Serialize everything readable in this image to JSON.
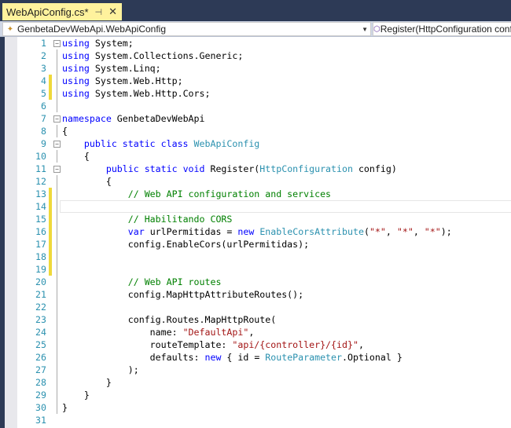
{
  "tab": {
    "title": "WebApiConfig.cs*",
    "pin_icon": "pin-icon",
    "close_icon": "close-icon"
  },
  "nav": {
    "class_combo": "GenbetaDevWebApi.WebApiConfig",
    "member_combo": "Register(HttpConfiguration config)"
  },
  "colors": {
    "keyword": "#0000ff",
    "type": "#2b91af",
    "string": "#a31515",
    "comment": "#008000",
    "changed": "#efd93b"
  },
  "lines": [
    {
      "n": "1",
      "fold": true,
      "chg": false,
      "tokens": [
        [
          "k",
          "using"
        ],
        [
          "p",
          " System;"
        ]
      ]
    },
    {
      "n": "2",
      "tokens": [
        [
          "k",
          "using"
        ],
        [
          "p",
          " System.Collections.Generic;"
        ]
      ]
    },
    {
      "n": "3",
      "tokens": [
        [
          "k",
          "using"
        ],
        [
          "p",
          " System.Linq;"
        ]
      ]
    },
    {
      "n": "4",
      "chg": true,
      "tokens": [
        [
          "k",
          "using"
        ],
        [
          "p",
          " System.Web.Http;"
        ]
      ]
    },
    {
      "n": "5",
      "chg": true,
      "tokens": [
        [
          "k",
          "using"
        ],
        [
          "p",
          " System.Web.Http.Cors;"
        ]
      ]
    },
    {
      "n": "6",
      "tokens": []
    },
    {
      "n": "7",
      "fold": true,
      "tokens": [
        [
          "k",
          "namespace"
        ],
        [
          "p",
          " GenbetaDevWebApi"
        ]
      ]
    },
    {
      "n": "8",
      "tokens": [
        [
          "p",
          "{"
        ]
      ]
    },
    {
      "n": "9",
      "fold": true,
      "tokens": [
        [
          "p",
          "    "
        ],
        [
          "k",
          "public static class"
        ],
        [
          "p",
          " "
        ],
        [
          "t",
          "WebApiConfig"
        ]
      ]
    },
    {
      "n": "10",
      "tokens": [
        [
          "p",
          "    {"
        ]
      ]
    },
    {
      "n": "11",
      "fold": true,
      "tokens": [
        [
          "p",
          "        "
        ],
        [
          "k",
          "public static void"
        ],
        [
          "p",
          " Register("
        ],
        [
          "t",
          "HttpConfiguration"
        ],
        [
          "p",
          " config)"
        ]
      ]
    },
    {
      "n": "12",
      "tokens": [
        [
          "p",
          "        {"
        ]
      ]
    },
    {
      "n": "13",
      "chg": true,
      "tokens": [
        [
          "p",
          "            "
        ],
        [
          "c",
          "// Web API configuration and services"
        ]
      ]
    },
    {
      "n": "14",
      "chg": true,
      "cur": true,
      "tokens": []
    },
    {
      "n": "15",
      "chg": true,
      "tokens": [
        [
          "p",
          "            "
        ],
        [
          "c",
          "// Habilitando CORS"
        ]
      ]
    },
    {
      "n": "16",
      "chg": true,
      "tokens": [
        [
          "p",
          "            "
        ],
        [
          "k",
          "var"
        ],
        [
          "p",
          " urlPermitidas = "
        ],
        [
          "k",
          "new"
        ],
        [
          "p",
          " "
        ],
        [
          "t",
          "EnableCorsAttribute"
        ],
        [
          "p",
          "("
        ],
        [
          "s",
          "\"*\""
        ],
        [
          "p",
          ", "
        ],
        [
          "s",
          "\"*\""
        ],
        [
          "p",
          ", "
        ],
        [
          "s",
          "\"*\""
        ],
        [
          "p",
          ");"
        ]
      ]
    },
    {
      "n": "17",
      "chg": true,
      "tokens": [
        [
          "p",
          "            config.EnableCors(urlPermitidas);"
        ]
      ]
    },
    {
      "n": "18",
      "chg": true,
      "tokens": []
    },
    {
      "n": "19",
      "chg": true,
      "tokens": []
    },
    {
      "n": "20",
      "tokens": [
        [
          "p",
          "            "
        ],
        [
          "c",
          "// Web API routes"
        ]
      ]
    },
    {
      "n": "21",
      "tokens": [
        [
          "p",
          "            config.MapHttpAttributeRoutes();"
        ]
      ]
    },
    {
      "n": "22",
      "tokens": []
    },
    {
      "n": "23",
      "tokens": [
        [
          "p",
          "            config.Routes.MapHttpRoute("
        ]
      ]
    },
    {
      "n": "24",
      "tokens": [
        [
          "p",
          "                name: "
        ],
        [
          "s",
          "\"DefaultApi\""
        ],
        [
          "p",
          ","
        ]
      ]
    },
    {
      "n": "25",
      "tokens": [
        [
          "p",
          "                routeTemplate: "
        ],
        [
          "s",
          "\"api/{controller}/{id}\""
        ],
        [
          "p",
          ","
        ]
      ]
    },
    {
      "n": "26",
      "tokens": [
        [
          "p",
          "                defaults: "
        ],
        [
          "k",
          "new"
        ],
        [
          "p",
          " { id = "
        ],
        [
          "t",
          "RouteParameter"
        ],
        [
          "p",
          ".Optional }"
        ]
      ]
    },
    {
      "n": "27",
      "tokens": [
        [
          "p",
          "            );"
        ]
      ]
    },
    {
      "n": "28",
      "tokens": [
        [
          "p",
          "        }"
        ]
      ]
    },
    {
      "n": "29",
      "tokens": [
        [
          "p",
          "    }"
        ]
      ]
    },
    {
      "n": "30",
      "tokens": [
        [
          "p",
          "}"
        ]
      ]
    },
    {
      "n": "31",
      "tokens": []
    }
  ]
}
